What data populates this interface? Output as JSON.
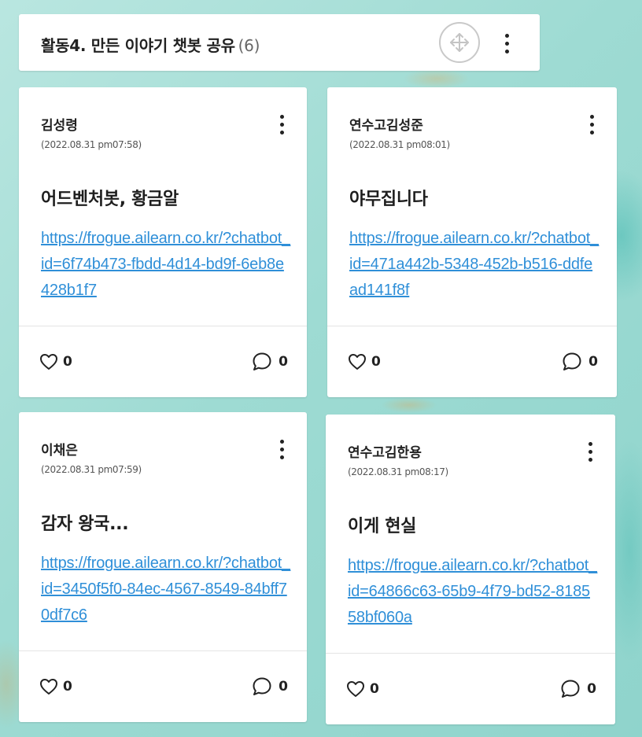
{
  "section": {
    "title": "활동4. 만든 이야기 챗봇 공유",
    "count": "(6)",
    "move_icon": "move-arrows-icon",
    "menu_icon": "more-vertical-icon"
  },
  "cards": [
    {
      "author": "김성령",
      "date": "(2022.08.31 pm07:58)",
      "title": "어드벤처봇, 황금알",
      "link": "https://frogue.ailearn.co.kr/?chatbot_id=6f74b473-fbdd-4d14-bd9f-6eb8e428b1f7",
      "likes": "0",
      "comments": "0"
    },
    {
      "author": "연수고김성준",
      "date": "(2022.08.31 pm08:01)",
      "title": "야무집니다",
      "link": "https://frogue.ailearn.co.kr/?chatbot_id=471a442b-5348-452b-b516-ddfead141f8f",
      "likes": "0",
      "comments": "0"
    },
    {
      "author": "이채은",
      "date": "(2022.08.31 pm07:59)",
      "title": "감자 왕국...",
      "link": "https://frogue.ailearn.co.kr/?chatbot_id=3450f5f0-84ec-4567-8549-84bff70df7c6",
      "likes": "0",
      "comments": "0"
    },
    {
      "author": "연수고김한용",
      "date": "(2022.08.31 pm08:17)",
      "title": "이게 현실",
      "link": "https://frogue.ailearn.co.kr/?chatbot_id=64866c63-65b9-4f79-bd52-818558bf060a",
      "likes": "0",
      "comments": "0"
    }
  ],
  "icons": {
    "like": "heart-outline-icon",
    "comment": "speech-bubble-icon",
    "card_menu": "more-vertical-icon"
  },
  "colors": {
    "link": "#2f8fd8",
    "background": "#9edbd3"
  }
}
